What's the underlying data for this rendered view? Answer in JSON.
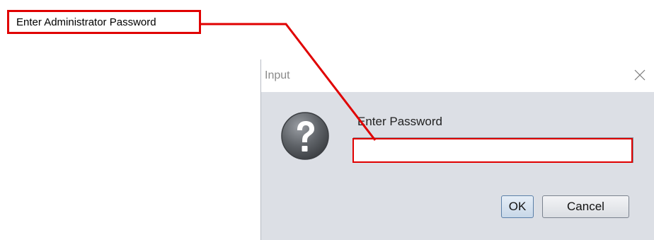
{
  "annotation": {
    "callout_text": "Enter Administrator Password",
    "highlight_color": "#e00000"
  },
  "dialog": {
    "title": "Input",
    "close_icon": "close-icon",
    "icon": "question-icon",
    "prompt": "Enter Password",
    "password_value": "",
    "ok_label": "OK",
    "cancel_label": "Cancel"
  }
}
